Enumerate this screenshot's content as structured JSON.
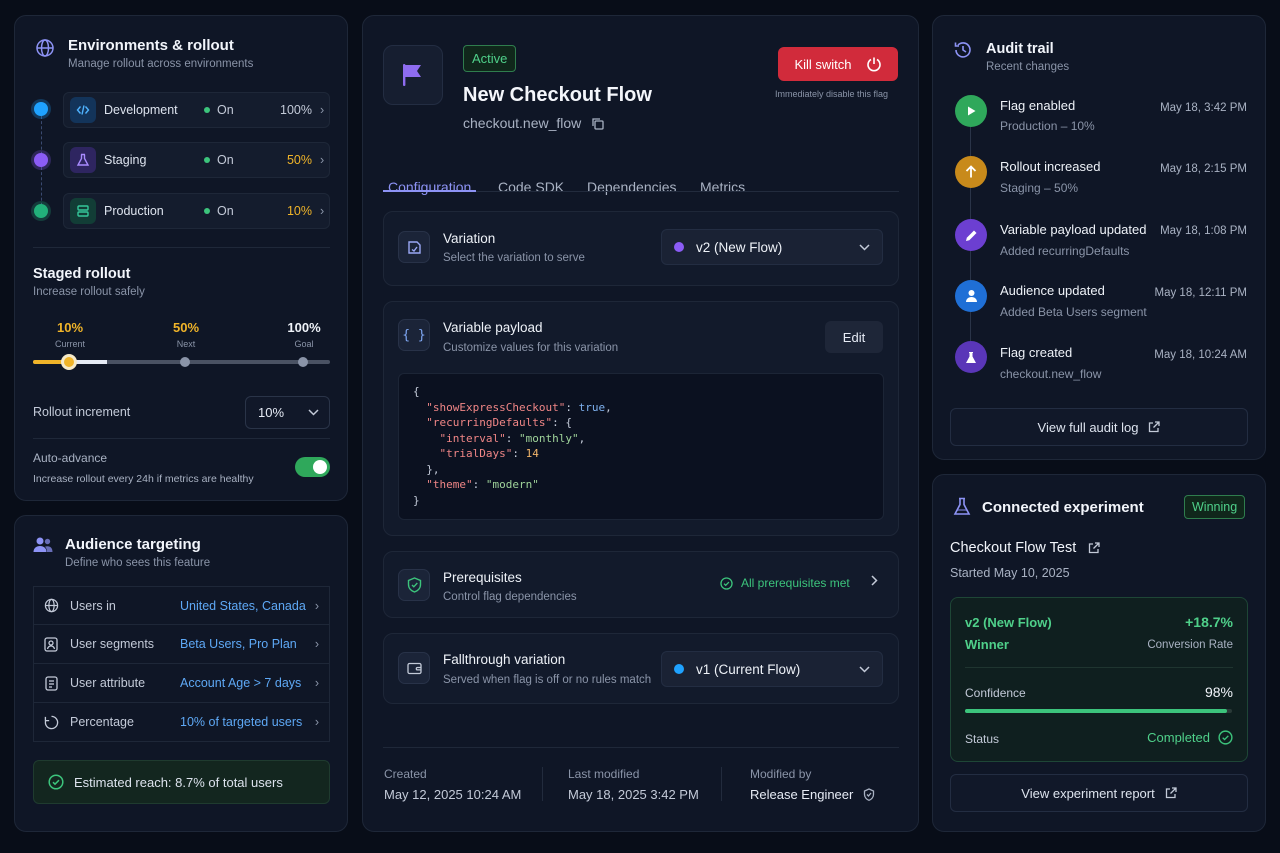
{
  "environments": {
    "title": "Environments & rollout",
    "subtitle": "Manage rollout across environments",
    "items": [
      {
        "name": "Development",
        "status": "On",
        "percent": "100%",
        "percent_color": "#c3cad8"
      },
      {
        "name": "Staging",
        "status": "On",
        "percent": "50%",
        "percent_color": "#f0b429"
      },
      {
        "name": "Production",
        "status": "On",
        "percent": "10%",
        "percent_color": "#f0b429"
      }
    ]
  },
  "staged_rollout": {
    "title": "Staged rollout",
    "subtitle": "Increase rollout safely",
    "steps": [
      {
        "value": "10%",
        "label": "Current"
      },
      {
        "value": "50%",
        "label": "Next"
      },
      {
        "value": "100%",
        "label": "Goal"
      }
    ],
    "current_fraction": 0.1,
    "increment_label": "Rollout increment",
    "increment_value": "10%",
    "auto_advance_label": "Auto-advance",
    "auto_advance_desc": "Increase rollout every 24h if metrics are healthy",
    "auto_advance_on": true
  },
  "audience": {
    "title": "Audience targeting",
    "subtitle": "Define who sees this feature",
    "rows": [
      {
        "label": "Users in",
        "value": "United States, Canada",
        "icon": "globe-icon"
      },
      {
        "label": "User segments",
        "value": "Beta Users, Pro Plan",
        "icon": "segment-icon"
      },
      {
        "label": "User attribute",
        "value": "Account Age > 7 days",
        "icon": "attribute-icon"
      },
      {
        "label": "Percentage",
        "value": "10% of targeted users",
        "icon": "percentage-icon"
      }
    ],
    "reach": "Estimated reach: 8.7% of total users"
  },
  "flag": {
    "status": "Active",
    "name": "New Checkout Flow",
    "key": "checkout.new_flow",
    "kill_switch_label": "Kill switch",
    "kill_switch_hint": "Immediately disable this flag",
    "tabs": [
      "Configuration",
      "Code SDK",
      "Dependencies",
      "Metrics"
    ],
    "active_tab": 0
  },
  "variation": {
    "title": "Variation",
    "subtitle": "Select the variation to serve",
    "selected": "v2 (New Flow)",
    "dot_color": "#8b5cf6"
  },
  "payload": {
    "title": "Variable payload",
    "subtitle": "Customize values for this variation",
    "edit_label": "Edit",
    "lines": [
      {
        "indent": 0,
        "parts": [
          [
            "p",
            "{"
          ]
        ]
      },
      {
        "indent": 1,
        "parts": [
          [
            "k",
            "\"showExpressCheckout\""
          ],
          [
            "p",
            ": "
          ],
          [
            "b",
            "true"
          ],
          [
            "p",
            ","
          ]
        ]
      },
      {
        "indent": 1,
        "parts": [
          [
            "k",
            "\"recurringDefaults\""
          ],
          [
            "p",
            ": {"
          ]
        ]
      },
      {
        "indent": 2,
        "parts": [
          [
            "k",
            "\"interval\""
          ],
          [
            "p",
            ": "
          ],
          [
            "s",
            "\"monthly\""
          ],
          [
            "p",
            ","
          ]
        ]
      },
      {
        "indent": 2,
        "parts": [
          [
            "k",
            "\"trialDays\""
          ],
          [
            "p",
            ": "
          ],
          [
            "n",
            "14"
          ]
        ]
      },
      {
        "indent": 1,
        "parts": [
          [
            "p",
            "},"
          ]
        ]
      },
      {
        "indent": 1,
        "parts": [
          [
            "k",
            "\"theme\""
          ],
          [
            "p",
            ": "
          ],
          [
            "s",
            "\"modern\""
          ]
        ]
      },
      {
        "indent": 0,
        "parts": [
          [
            "p",
            "}"
          ]
        ]
      }
    ]
  },
  "prerequisites": {
    "title": "Prerequisites",
    "subtitle": "Control flag dependencies",
    "status": "All prerequisites met"
  },
  "fallthrough": {
    "title": "Fallthrough variation",
    "subtitle": "Served when flag is off or no rules match",
    "selected": "v1 (Current Flow)",
    "dot_color": "#1fa2ff"
  },
  "meta": {
    "created_label": "Created",
    "created": "May 12, 2025 10:24 AM",
    "modified_label": "Last modified",
    "modified": "May 18, 2025 3:42 PM",
    "modified_by_label": "Modified by",
    "modified_by": "Release Engineer"
  },
  "audit": {
    "title": "Audit trail",
    "subtitle": "Recent changes",
    "events": [
      {
        "title": "Flag enabled",
        "sub": "Production – 10%",
        "time": "May 18, 3:42 PM",
        "color": "#2fa85b",
        "icon": "play-icon"
      },
      {
        "title": "Rollout increased",
        "sub": "Staging – 50%",
        "time": "May 18, 2:15 PM",
        "color": "#c88a1b",
        "icon": "arrow-up-icon"
      },
      {
        "title": "Variable payload updated",
        "sub": "Added recurringDefaults",
        "time": "May 18, 1:08 PM",
        "color": "#6c3fd1",
        "icon": "pencil-icon"
      },
      {
        "title": "Audience updated",
        "sub": "Added Beta Users segment",
        "time": "May 18, 12:11 PM",
        "color": "#1f6fd6",
        "icon": "user-icon"
      },
      {
        "title": "Flag created",
        "sub": "checkout.new_flow",
        "time": "May 18, 10:24 AM",
        "color": "#5a36b8",
        "icon": "flask-icon"
      }
    ],
    "view_log": "View full audit log"
  },
  "experiment": {
    "title": "Connected experiment",
    "badge": "Winning",
    "name": "Checkout Flow Test",
    "started": "Started May 10, 2025",
    "variant": "v2 (New Flow)",
    "lift": "+18.7%",
    "winner": "Winner",
    "metric": "Conversion Rate",
    "confidence_label": "Confidence",
    "confidence": "98%",
    "confidence_fraction": 0.98,
    "status_label": "Status",
    "status": "Completed",
    "report": "View experiment report"
  }
}
